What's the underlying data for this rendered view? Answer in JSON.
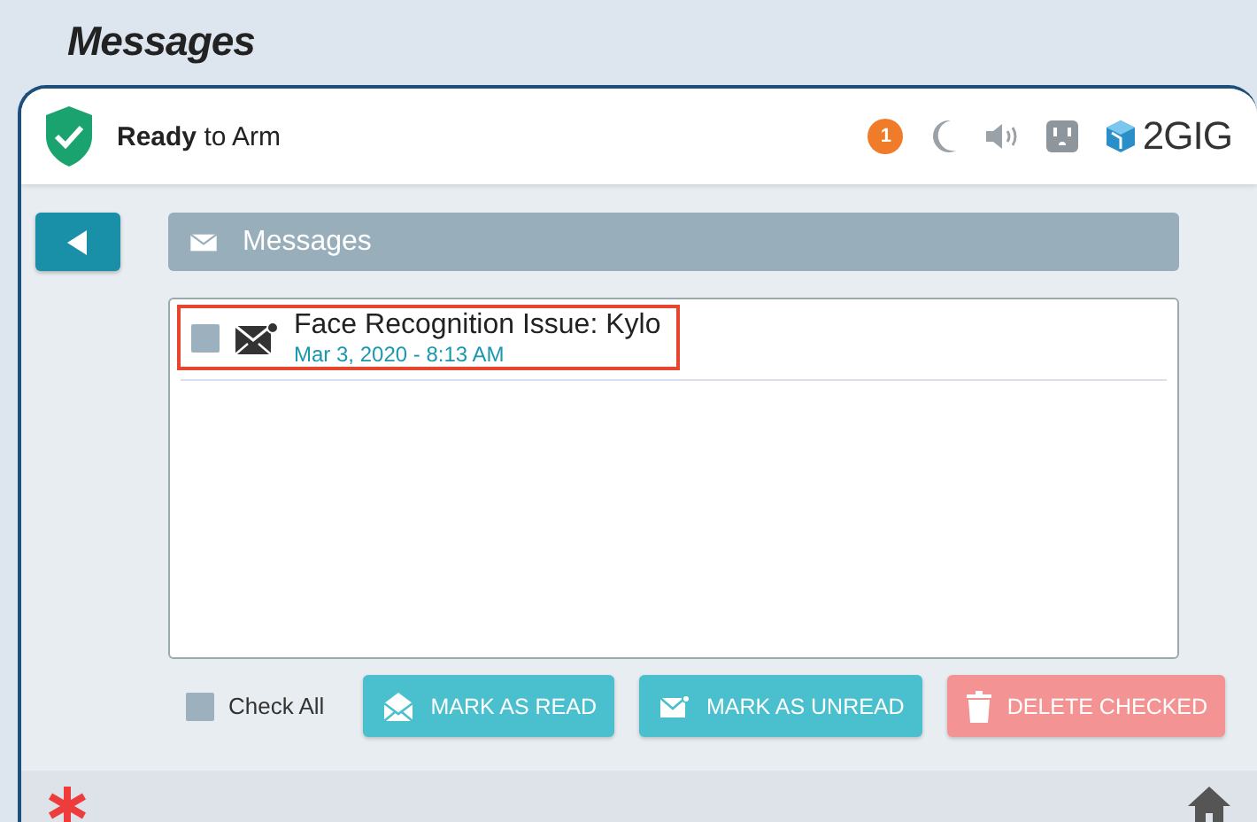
{
  "page_title": "Messages",
  "header": {
    "status": "**Ready** to Arm",
    "alert_count": "1",
    "logo": "2GIG"
  },
  "panel": {
    "title": "Messages"
  },
  "messages": [
    {
      "subject": "Face Recognition Issue: Kylo",
      "date": "Mar 3, 2020 - 8:13 AM",
      "checked": false,
      "highlighted": true
    }
  ],
  "check_all": {
    "label": "Check All",
    "checked": false
  },
  "actions": [
    {
      "kind": "read",
      "label": "MARK AS READ"
    },
    {
      "kind": "unread",
      "label": "MARK AS UNREAD"
    },
    {
      "kind": "delete",
      "label": "DELETE CHECKED"
    }
  ]
}
